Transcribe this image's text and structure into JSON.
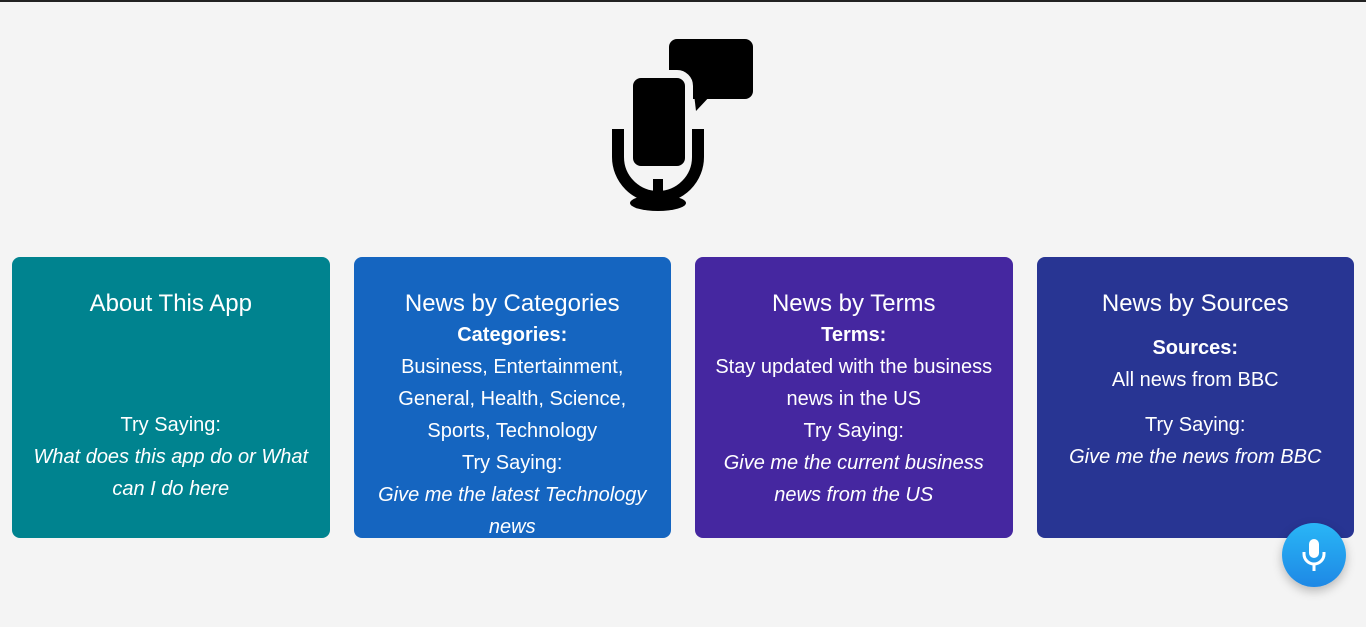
{
  "logo": {
    "icon": "microphone-chat-icon"
  },
  "cards": [
    {
      "title": "About This App",
      "try_label": "Try Saying:",
      "example": "What does this app do or What can I do here",
      "color": "#00838f"
    },
    {
      "title": "News by Categories",
      "label": "Categories:",
      "text": "Business, Entertainment, General, Health, Science, Sports, Technology",
      "try_label": "Try Saying:",
      "example": "Give me the latest Technology news",
      "color": "#1565c0"
    },
    {
      "title": "News by Terms",
      "label": "Terms:",
      "text": "Stay updated with the business news in the US",
      "try_label": "Try Saying:",
      "example": "Give me the current business news from the US",
      "color": "#4527a0"
    },
    {
      "title": "News by Sources",
      "label": "Sources:",
      "text": "All news from BBC",
      "try_label": "Try Saying:",
      "example": "Give me the news from BBC",
      "color": "#283593"
    }
  ],
  "voice_button": {
    "icon": "microphone-icon"
  }
}
